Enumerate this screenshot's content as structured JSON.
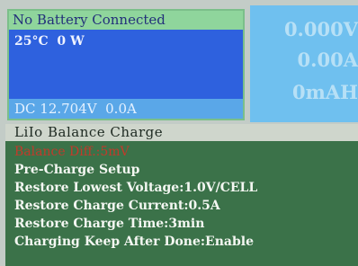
{
  "status": {
    "header": "No Battery Connected",
    "temperature": "25°C",
    "power": "0 W",
    "dc_voltage": "DC 12.704V",
    "dc_current": "0.0A"
  },
  "readouts": {
    "voltage": "0.000V",
    "current": "0.00A",
    "capacity": "0mAH"
  },
  "menu": {
    "title": "LiIo Balance Charge",
    "items": [
      {
        "label": "Balance Diff.:5mV"
      },
      {
        "label": "Pre-Charge Setup"
      },
      {
        "label": "Restore Lowest Voltage:1.0V/CELL"
      },
      {
        "label": "Restore Charge Current:0.5A"
      },
      {
        "label": "Restore Charge Time:3min"
      },
      {
        "label": "Charging Keep After Done:Enable"
      }
    ]
  },
  "colors": {
    "status_header_bg": "#8fd59c",
    "status_body_bg": "#2e61de",
    "status_footer_bg": "#5aa7e8",
    "readout_bg": "#6fc0ef",
    "menu_bg": "#3b7249",
    "menu_selected_text": "#c23a2a"
  }
}
